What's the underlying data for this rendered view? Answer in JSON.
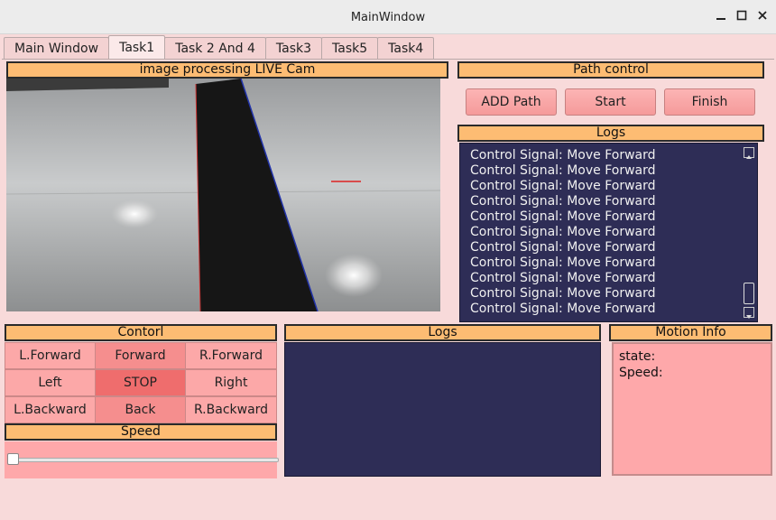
{
  "window": {
    "title": "MainWindow",
    "controls": [
      "minimize-icon",
      "maximize-icon",
      "close-icon"
    ]
  },
  "tabs": [
    {
      "label": "Main Window",
      "active": false
    },
    {
      "label": "Task1",
      "active": true
    },
    {
      "label": "Task 2 And 4",
      "active": false
    },
    {
      "label": "Task3",
      "active": false
    },
    {
      "label": "Task5",
      "active": false
    },
    {
      "label": "Task4",
      "active": false
    }
  ],
  "camera": {
    "header": "image processing LIVE Cam"
  },
  "path_control": {
    "header": "Path control",
    "add_label": "ADD Path",
    "start_label": "Start",
    "finish_label": "Finish"
  },
  "logs_top": {
    "header": "Logs",
    "lines": [
      "Control Signal: Move Forward",
      "Control Signal: Move Forward",
      "Control Signal: Move Forward",
      "Control Signal: Move Forward",
      "Control Signal: Move Forward",
      "Control Signal: Move Forward",
      "Control Signal: Move Forward",
      "Control Signal: Move Forward",
      "Control Signal: Move Forward",
      "Control Signal: Move Forward",
      "Control Signal: Move Forward"
    ]
  },
  "control": {
    "header": "Contorl",
    "buttons": {
      "lforward": "L.Forward",
      "forward": "Forward",
      "rforward": "R.Forward",
      "left": "Left",
      "stop": "STOP",
      "right": "Right",
      "lbackward": "L.Backward",
      "back": "Back",
      "rbackward": "R.Backward"
    }
  },
  "speed": {
    "header": "Speed",
    "value": 0
  },
  "logs_bottom": {
    "header": "Logs"
  },
  "motion_info": {
    "header": "Motion Info",
    "state_label": "state:",
    "speed_label": "Speed:"
  },
  "colors": {
    "header_bg": "#fdbc73",
    "log_bg": "#2e2d56",
    "panel_pink": "#fea8aa",
    "stop_red": "#ef6d6d"
  }
}
